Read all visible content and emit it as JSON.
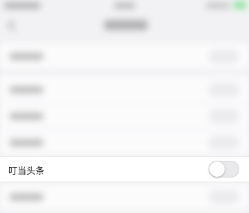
{
  "settings": {
    "focused_row": {
      "label": "叮当头条",
      "toggle_on": false
    }
  },
  "colors": {
    "background": "#f2f2f4",
    "row_background": "#ffffff",
    "toggle_off": "#e9e9eb",
    "battery": "#4cd964"
  },
  "icons": [
    "back-chevron-icon",
    "battery-icon"
  ]
}
